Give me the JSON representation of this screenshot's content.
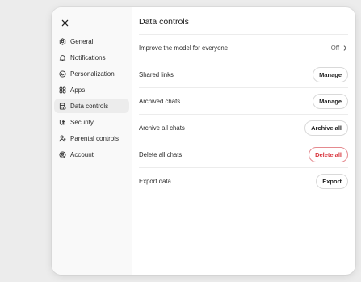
{
  "sidebar": {
    "items": [
      {
        "label": "General",
        "icon": "gear-icon"
      },
      {
        "label": "Notifications",
        "icon": "bell-icon"
      },
      {
        "label": "Personalization",
        "icon": "personalization-icon"
      },
      {
        "label": "Apps",
        "icon": "apps-grid-icon"
      },
      {
        "label": "Data controls",
        "icon": "database-icon",
        "active": true
      },
      {
        "label": "Security",
        "icon": "security-icon"
      },
      {
        "label": "Parental controls",
        "icon": "parental-controls-icon"
      },
      {
        "label": "Account",
        "icon": "account-icon"
      }
    ]
  },
  "main": {
    "title": "Data controls",
    "rows": [
      {
        "label": "Improve the model for everyone",
        "value": "Off"
      },
      {
        "label": "Shared links",
        "action": "Manage"
      },
      {
        "label": "Archived chats",
        "action": "Manage"
      },
      {
        "label": "Archive all chats",
        "action": "Archive all"
      },
      {
        "label": "Delete all chats",
        "action": "Delete all"
      },
      {
        "label": "Export data",
        "action": "Export"
      }
    ]
  },
  "colors": {
    "background": "#ececec",
    "sidebar": "#f9f9f9",
    "active_item": "#ececec",
    "danger": "#d9363e"
  }
}
